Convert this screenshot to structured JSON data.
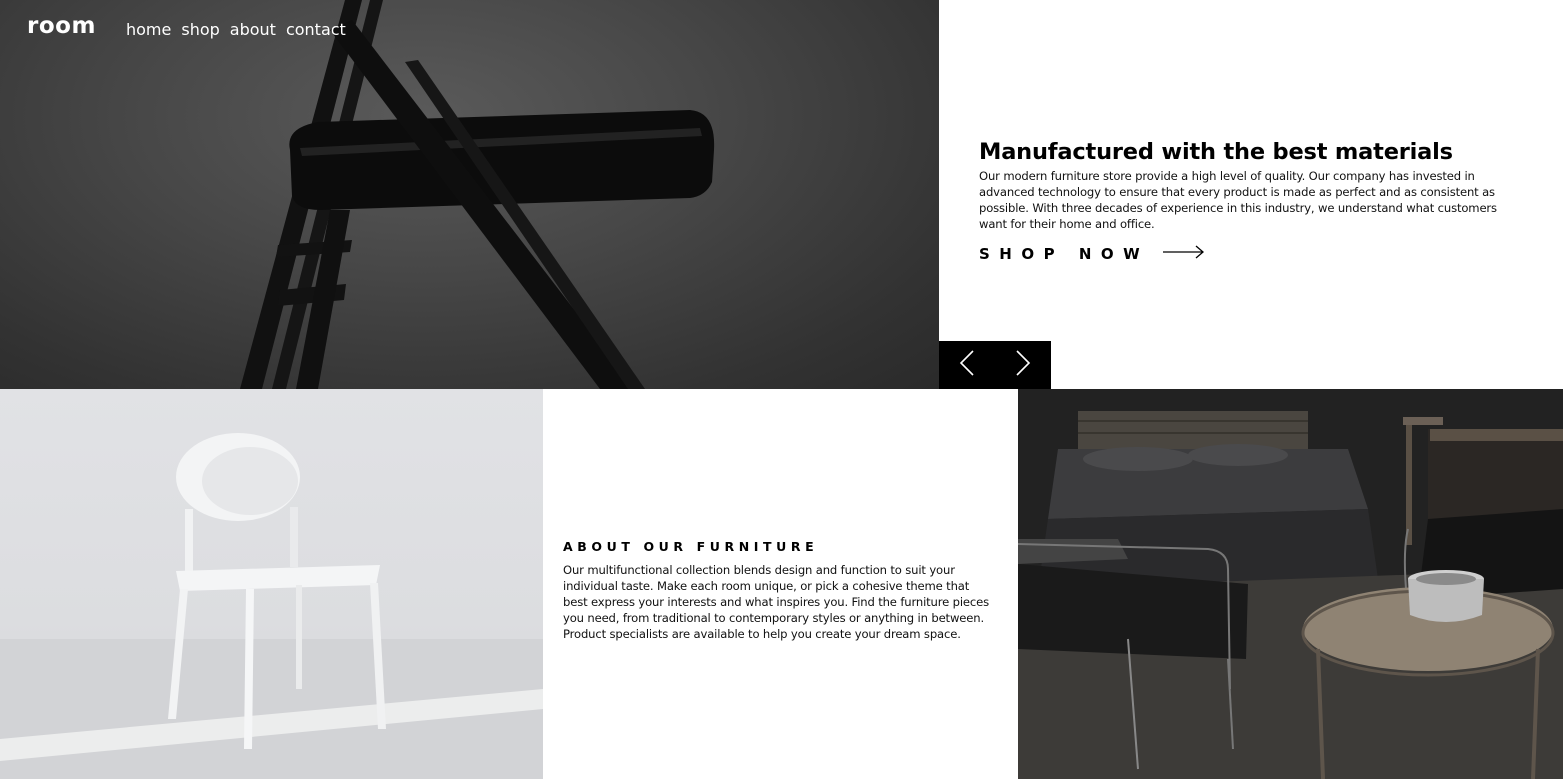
{
  "brand": {
    "logo": "room"
  },
  "nav": {
    "items": [
      "home",
      "shop",
      "about",
      "contact"
    ]
  },
  "hero": {
    "title": "Manufactured with the best materials",
    "description": "Our modern furniture store provide a high level of quality. Our company has invested in advanced technology to ensure that every product is made as perfect and as consistent as possible. With three decades of experience in this industry, we understand what customers want for their home and office.",
    "cta_label": "SHOP NOW",
    "cta_icon": "arrow-right-icon"
  },
  "slider": {
    "prev_icon": "chevron-left-icon",
    "next_icon": "chevron-right-icon"
  },
  "about": {
    "title": "ABOUT OUR FURNITURE",
    "description": "Our multifunctional collection blends design and function to suit your individual taste. Make each room unique, or pick a cohesive theme that best express your interests and what inspires you. Find the furniture pieces you need, from traditional to contemporary styles or anything in between. Product specialists are available to help you create your dream space."
  },
  "colors": {
    "background": "#ffffff",
    "text": "#000000",
    "slider_bg": "#000000",
    "nav_text": "#ffffff"
  }
}
